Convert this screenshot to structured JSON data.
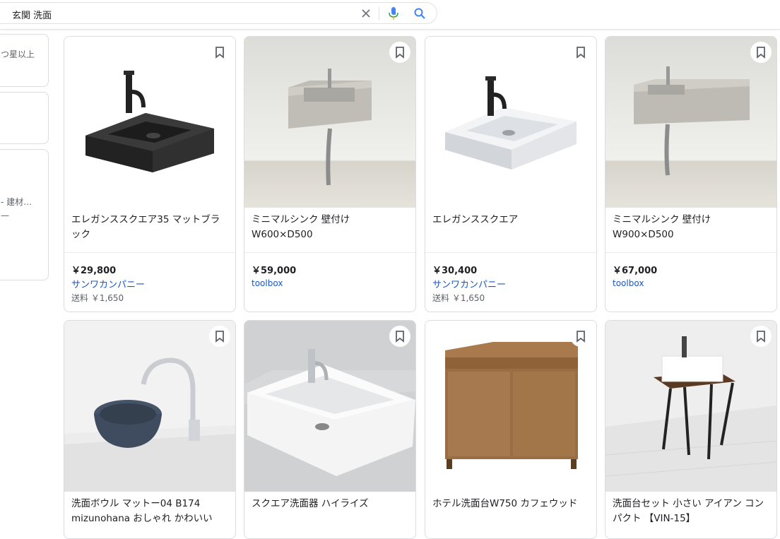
{
  "search": {
    "query": "玄関 洗面"
  },
  "sidebar": {
    "items": [
      {
        "label": "つ星以上"
      },
      {
        "label": ""
      },
      {
        "label": "- 建材…"
      }
    ]
  },
  "products": [
    {
      "title": "エレガンススクエア35 マットブラック",
      "price": "￥29,800",
      "seller": "サンワカンパニー",
      "shipping": "送料 ￥1,650"
    },
    {
      "title": "ミニマルシンク 壁付け W600×D500",
      "price": "￥59,000",
      "seller": "toolbox",
      "shipping": ""
    },
    {
      "title": "エレガンススクエア",
      "price": "￥30,400",
      "seller": "サンワカンパニー",
      "shipping": "送料 ￥1,650"
    },
    {
      "title": "ミニマルシンク 壁付け W900×D500",
      "price": "￥67,000",
      "seller": "toolbox",
      "shipping": ""
    },
    {
      "title": "洗面ボウル マットー04 B174 mizunohana おしゃれ かわいい",
      "price": "",
      "seller": "",
      "shipping": ""
    },
    {
      "title": "スクエア洗面器 ハイライズ",
      "price": "",
      "seller": "",
      "shipping": ""
    },
    {
      "title": "ホテル洗面台W750 カフェウッド",
      "price": "",
      "seller": "",
      "shipping": ""
    },
    {
      "title": "洗面台セット 小さい アイアン コンパクト 【VIN-15】",
      "price": "",
      "seller": "",
      "shipping": ""
    }
  ],
  "colors": {
    "link": "#1a56c4",
    "border": "#dadce0"
  }
}
